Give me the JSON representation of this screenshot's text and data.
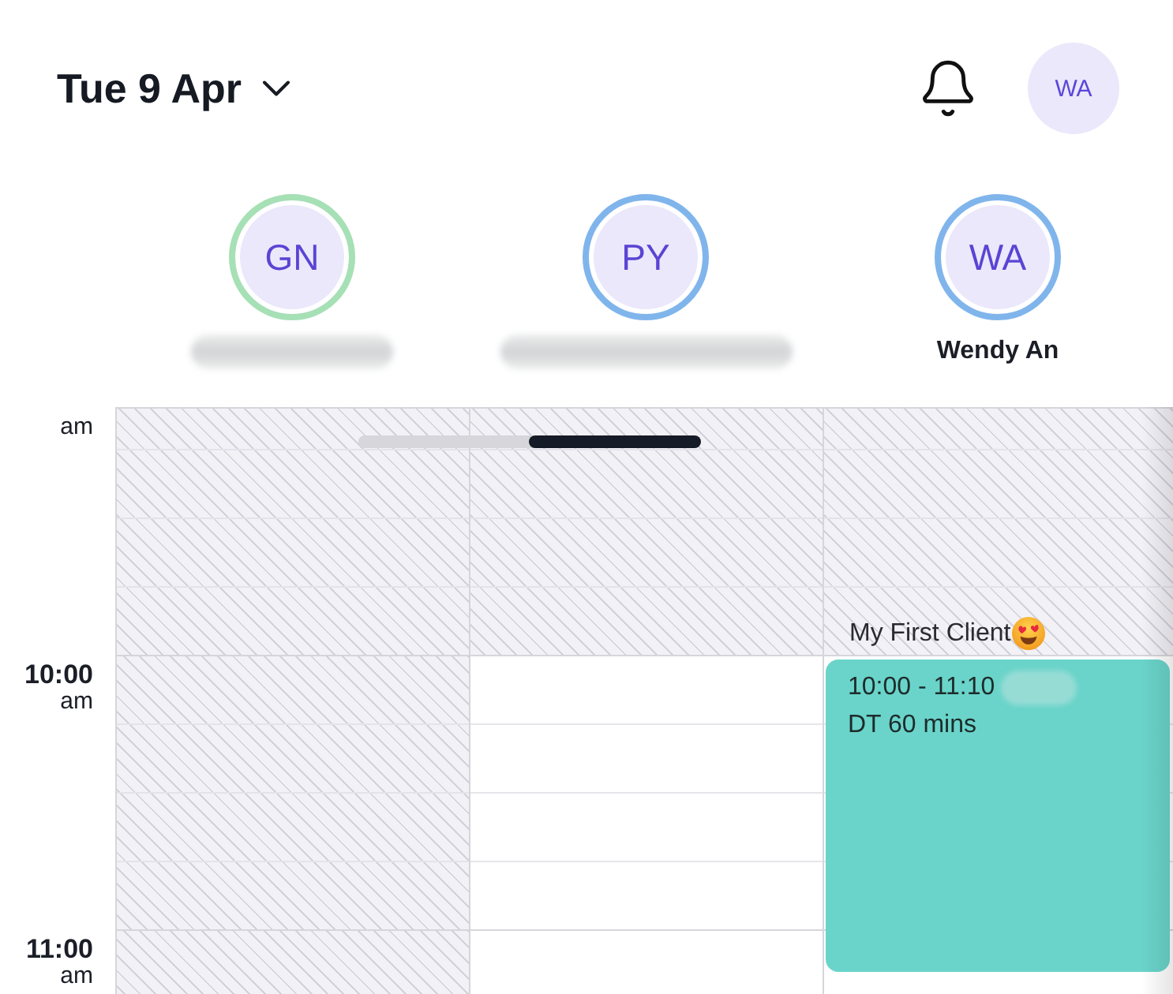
{
  "header": {
    "date": "Tue 9 Apr",
    "user_initials": "WA"
  },
  "staff": [
    {
      "initials": "GN",
      "color": "#a6e0b5",
      "name_hidden": true
    },
    {
      "initials": "PY",
      "color": "#80b5ec",
      "name_hidden": true
    },
    {
      "initials": "WA",
      "color": "#80b5ec",
      "name_hidden": false,
      "name": "Wendy An"
    }
  ],
  "schedule": {
    "hours": [
      {
        "suffix": "am"
      },
      {
        "hour": "10:00",
        "suffix": "am"
      },
      {
        "hour": "11:00",
        "suffix": "am"
      }
    ],
    "columns": [
      {
        "cells": [
          {
            "blocked": true
          },
          {
            "blocked": true
          },
          {
            "blocked": true
          }
        ]
      },
      {
        "cells": [
          {
            "blocked": true
          },
          {
            "blocked": false
          },
          {
            "blocked": false
          }
        ]
      },
      {
        "cells": [
          {
            "blocked": true
          },
          {
            "blocked": false,
            "event": {
              "title": "My First Client",
              "time": "10:00 - 11:10",
              "detail_hidden": true,
              "service": "DT 60 mins",
              "color": "#6ad4ca"
            }
          },
          {
            "blocked": false
          }
        ]
      }
    ]
  }
}
